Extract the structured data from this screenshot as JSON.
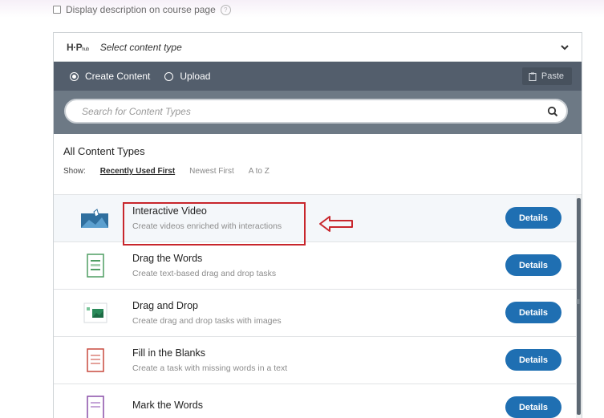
{
  "settings": {
    "display_description_label": "Display description on course page"
  },
  "hub": {
    "logo_text": "H·P",
    "logo_sub": "hub",
    "header_title": "Select content type",
    "tabs": [
      {
        "label": "Create Content",
        "selected": true
      },
      {
        "label": "Upload",
        "selected": false
      }
    ],
    "paste_label": "Paste",
    "search_placeholder": "Search for Content Types",
    "types_title": "All Content Types",
    "sort": {
      "show_label": "Show:",
      "options": [
        "Recently Used First",
        "Newest First",
        "A to Z"
      ],
      "active": "Recently Used First"
    },
    "items": [
      {
        "title": "Interactive Video",
        "description": "Create videos enriched with interactions",
        "button": "Details",
        "icon": "interactive-video-icon"
      },
      {
        "title": "Drag the Words",
        "description": "Create text-based drag and drop tasks",
        "button": "Details",
        "icon": "drag-the-words-icon"
      },
      {
        "title": "Drag and Drop",
        "description": "Create drag and drop tasks with images",
        "button": "Details",
        "icon": "drag-and-drop-icon"
      },
      {
        "title": "Fill in the Blanks",
        "description": "Create a task with missing words in a text",
        "button": "Details",
        "icon": "fill-in-the-blanks-icon"
      },
      {
        "title": "Mark the Words",
        "description": "",
        "button": "Details",
        "icon": "mark-the-words-icon"
      }
    ]
  },
  "colors": {
    "tabbar": "#535e6c",
    "search_band": "#6d7985",
    "details_button": "#1f6fb2",
    "annotation": "#c8262c"
  }
}
